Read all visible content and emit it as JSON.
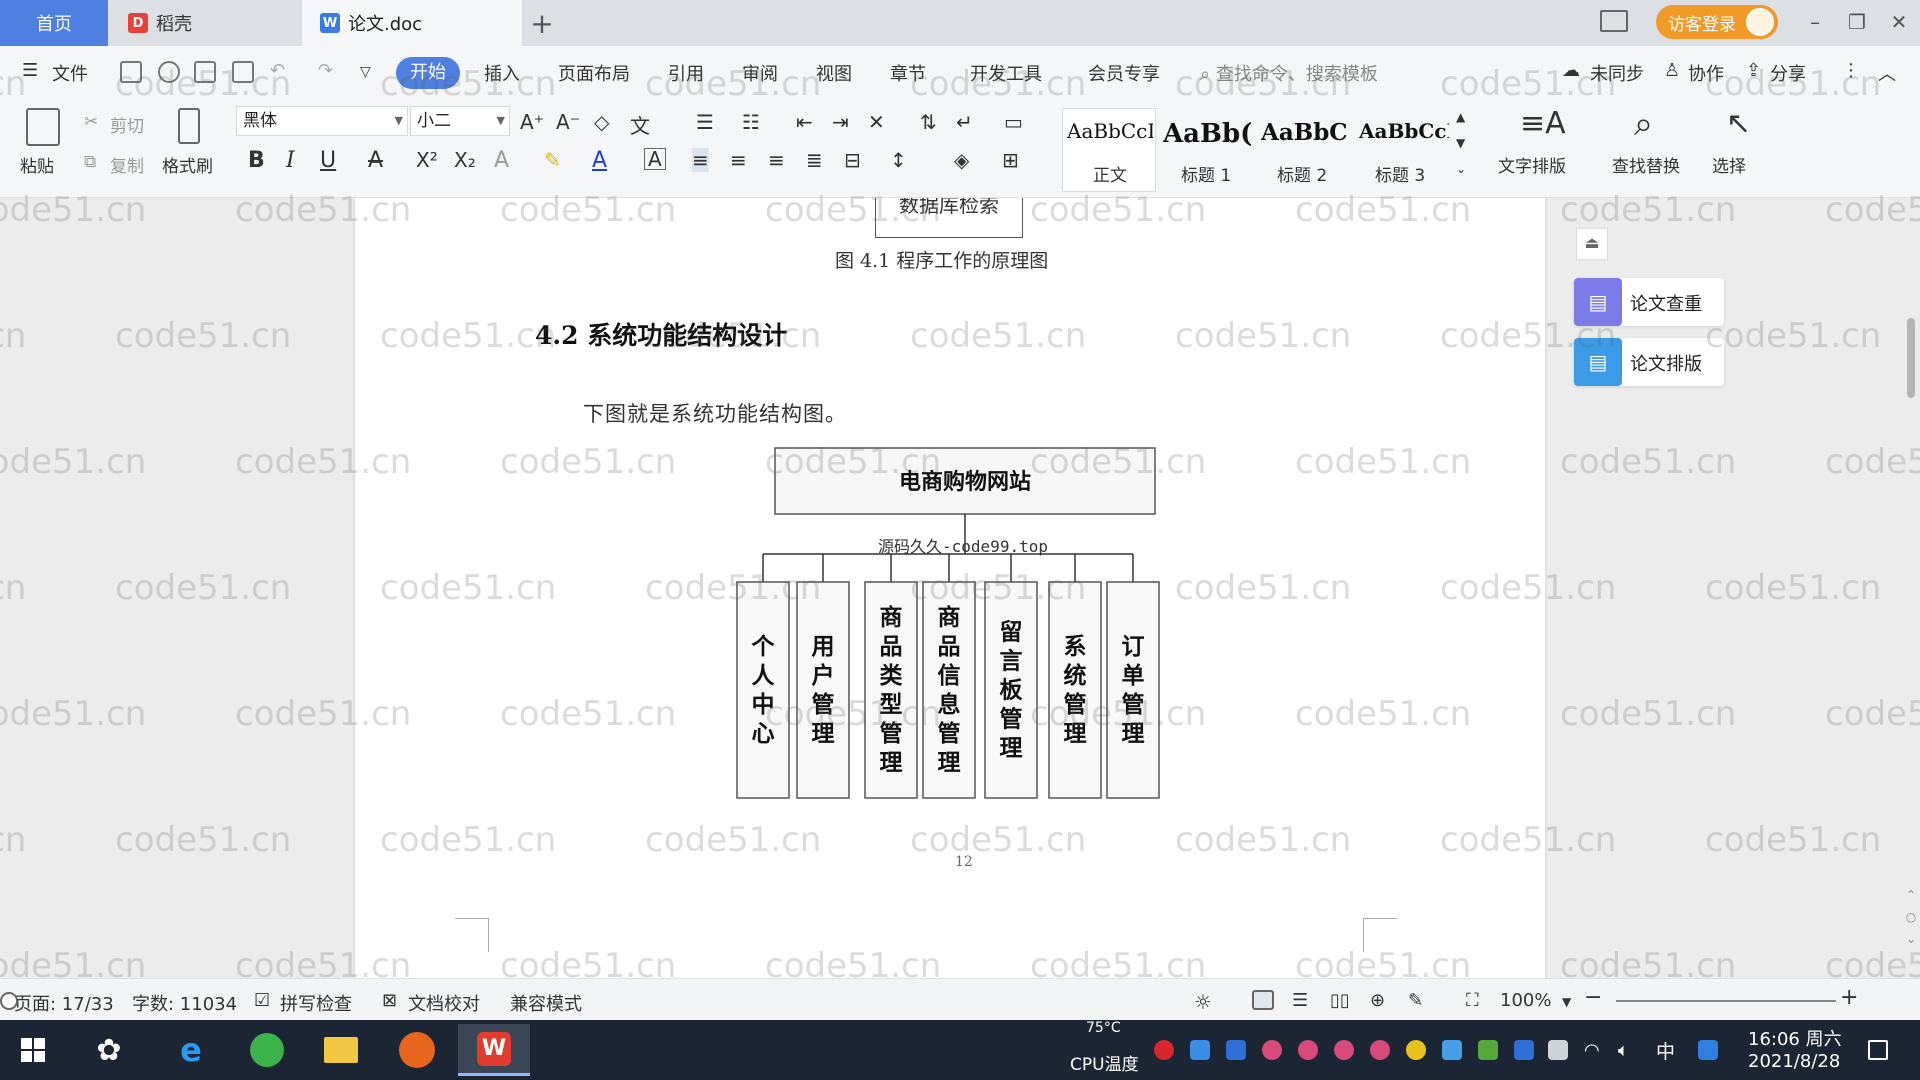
{
  "tabs": {
    "home": "首页",
    "docer": "稻壳",
    "document": "论文.doc"
  },
  "titlebar": {
    "visitor_login": "访客登录"
  },
  "menu": {
    "file": "文件",
    "start": "开始",
    "insert": "插入",
    "page_layout": "页面布局",
    "reference": "引用",
    "review": "审阅",
    "view": "视图",
    "chapter": "章节",
    "dev_tools": "开发工具",
    "member": "会员专享",
    "search_placeholder": "查找命令、搜索模板",
    "unsynced": "未同步",
    "collaborate": "协作",
    "share": "分享"
  },
  "ribbon": {
    "paste": "粘贴",
    "cut": "剪切",
    "copy": "复制",
    "format_painter": "格式刷",
    "font_name": "黑体",
    "font_size": "小二",
    "styles": [
      {
        "sample": "AaBbCcI",
        "name": "正文"
      },
      {
        "sample": "AaBb(",
        "name": "标题 1"
      },
      {
        "sample": "AaBbC",
        "name": "标题 2"
      },
      {
        "sample": "AaBbCcI",
        "name": "标题 3"
      }
    ],
    "text_layout": "文字排版",
    "find_replace": "查找替换",
    "select": "选择"
  },
  "document": {
    "top_box_text": "数据库检索",
    "figure_caption": "图 4.1  程序工作的原理图",
    "section_heading": "4.2 系统功能结构设计",
    "paragraph": "下图就是系统功能结构图。",
    "page_number": "12"
  },
  "chart_data": {
    "type": "diagram",
    "root": "电商购物网站",
    "overlay_text": "源码久久-code99.top",
    "children": [
      "个人中心",
      "用户管理",
      "商品类型管理",
      "商品信息管理",
      "留言板管理",
      "系统管理",
      "订单管理"
    ]
  },
  "side_panel": {
    "check": "论文查重",
    "layout": "论文排版"
  },
  "statusbar": {
    "page": "页面: 17/33",
    "words": "字数: 11034",
    "spell_check": "拼写检查",
    "doc_proof": "文档校对",
    "compat_mode": "兼容模式",
    "zoom": "100%"
  },
  "taskbar": {
    "cpu_temp": "75°C",
    "cpu_label": "CPU温度",
    "ime": "中",
    "time": "16:06 周六",
    "date": "2021/8/28"
  },
  "watermark": "code51.cn"
}
